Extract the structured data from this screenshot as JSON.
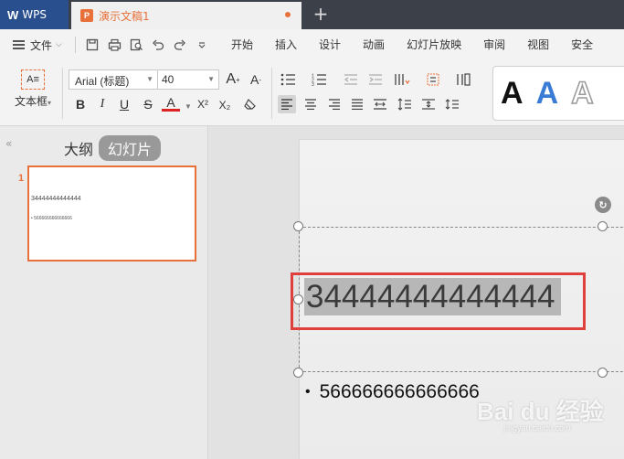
{
  "titlebar": {
    "app_label": "WPS",
    "doc_tab": "演示文稿1",
    "new_tab": "+"
  },
  "menubar": {
    "file": "文件",
    "tabs": [
      "开始",
      "插入",
      "设计",
      "动画",
      "幻灯片放映",
      "审阅",
      "视图",
      "安全"
    ]
  },
  "ribbon": {
    "textbox_label": "文本框",
    "textbox_caret": "▾",
    "font_name": "Arial (标题)",
    "font_size": "40",
    "grow_font": "A",
    "shrink_font": "A",
    "bold": "B",
    "italic": "I",
    "underline": "U",
    "strike": "S",
    "font_color": "A",
    "superscript": "X²",
    "subscript": "X₂",
    "style_letters": [
      "A",
      "A",
      "A"
    ]
  },
  "leftpanel": {
    "collapse": "«",
    "outline_tab": "大纲",
    "slides_tab": "幻灯片",
    "slide_number": "1",
    "thumb_title": "34444444444444",
    "thumb_bullet": "• 566666666666666"
  },
  "slide": {
    "title": "34444444444444",
    "bullet": "•",
    "body": "566666666666666"
  },
  "watermark": {
    "main": "Bai du 经验",
    "sub": "jingyan.baidu.com"
  },
  "colors": {
    "accent": "#e8703a",
    "highlight": "#e0403c",
    "wps_blue": "#2a4f8f"
  }
}
